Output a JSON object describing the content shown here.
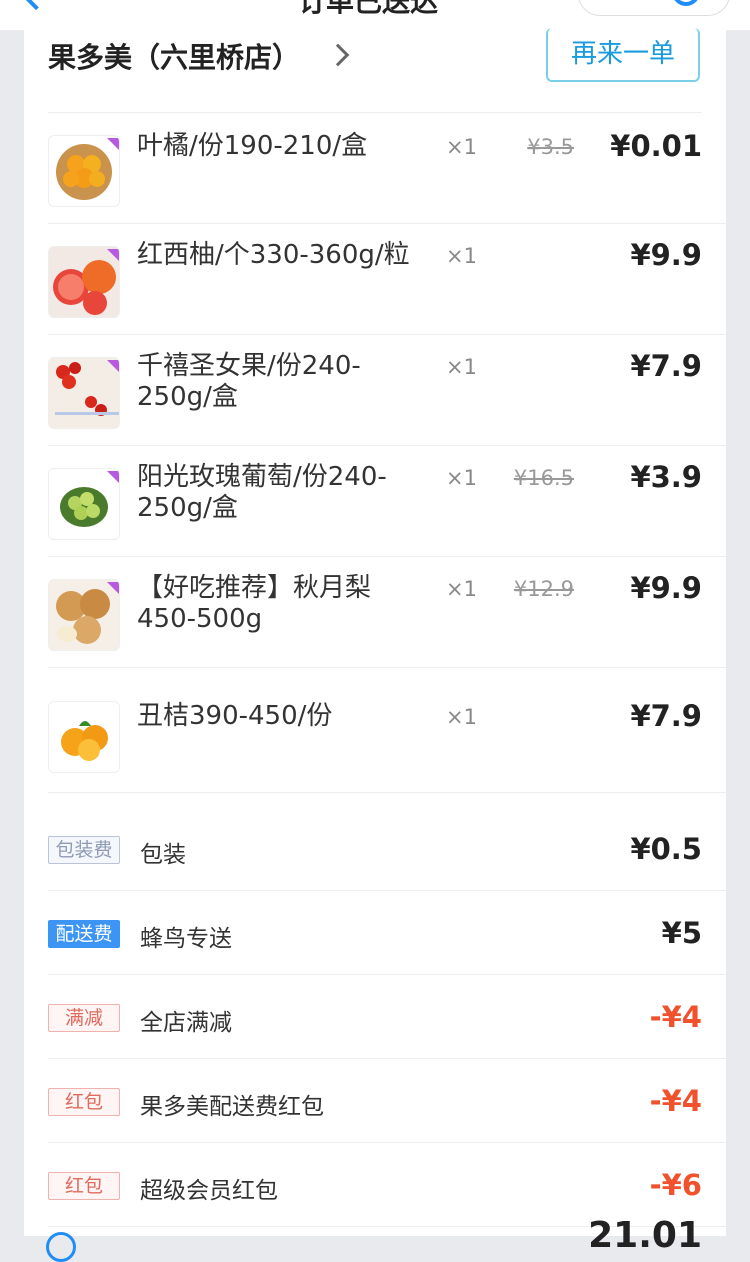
{
  "nav": {
    "title": "订单已送达"
  },
  "shop": {
    "name": "果多美（六里桥店）",
    "reorder_label": "再来一单"
  },
  "items": [
    {
      "name": "叶橘/份190-210/盒",
      "qty": "×1",
      "original_price": "¥3.5",
      "price": "¥0.01",
      "thumb": "orange-basket"
    },
    {
      "name": "红西柚/个330-360g/粒",
      "qty": "×1",
      "original_price": "",
      "price": "¥9.9",
      "thumb": "grapefruit"
    },
    {
      "name": "千禧圣女果/份240-250g/盒",
      "qty": "×1",
      "original_price": "",
      "price": "¥7.9",
      "thumb": "cherry-tomato"
    },
    {
      "name": "阳光玫瑰葡萄/份240-250g/盒",
      "qty": "×1",
      "original_price": "¥16.5",
      "price": "¥3.9",
      "thumb": "grape"
    },
    {
      "name": "【好吃推荐】秋月梨450-500g",
      "qty": "×1",
      "original_price": "¥12.9",
      "price": "¥9.9",
      "thumb": "pear"
    },
    {
      "name": "丑桔390-450/份",
      "qty": "×1",
      "original_price": "",
      "price": "¥7.9",
      "thumb": "tangerine"
    }
  ],
  "fees": [
    {
      "tag": "包装费",
      "label": "包装",
      "amount": "¥0.5",
      "tag_style": "pack",
      "negative": false
    },
    {
      "tag": "配送费",
      "label": "蜂鸟专送",
      "amount": "¥5",
      "tag_style": "ship",
      "negative": false
    },
    {
      "tag": "满减",
      "label": "全店满减",
      "amount": "-¥4",
      "tag_style": "red",
      "negative": true
    },
    {
      "tag": "红包",
      "label": "果多美配送费红包",
      "amount": "-¥4",
      "tag_style": "red",
      "negative": true
    },
    {
      "tag": "红包",
      "label": "超级会员红包",
      "amount": "-¥6",
      "tag_style": "red",
      "negative": true
    }
  ],
  "total": "21.01",
  "colors": {
    "accent": "#1f8df5",
    "discount_red": "#f2512d",
    "ship_tag_blue": "#3c94f5"
  }
}
